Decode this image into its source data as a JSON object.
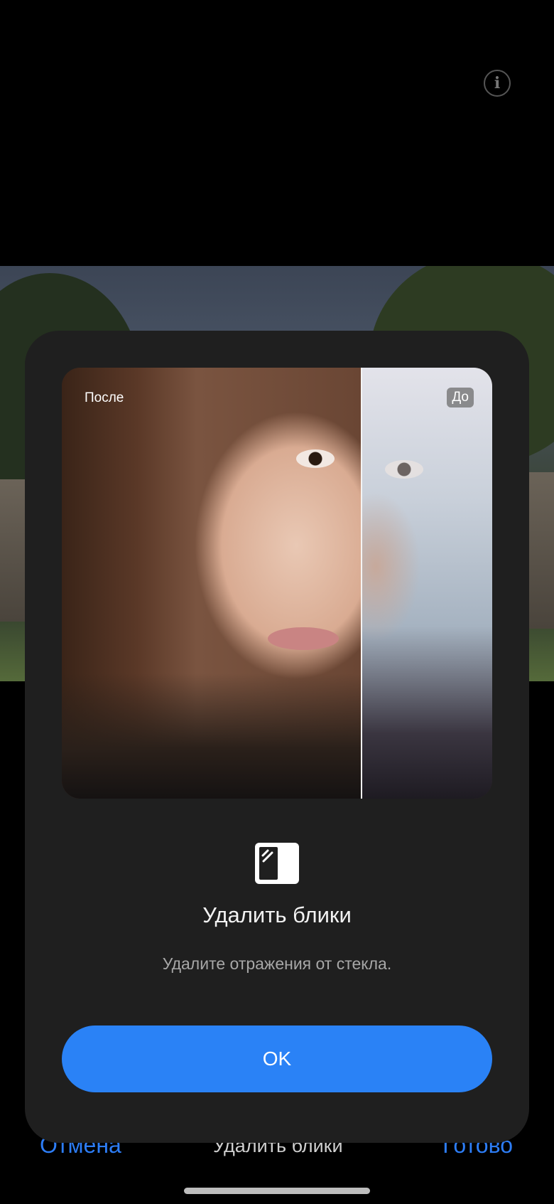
{
  "top_bar": {
    "info_icon": "info-circle-icon",
    "info_glyph": "i"
  },
  "bottom_bar": {
    "cancel_label": "Отмена",
    "mode_label": "Удалить блики",
    "done_label": "Готово"
  },
  "dialog": {
    "comparison": {
      "after_label": "После",
      "before_label": "До"
    },
    "feature_icon": "glass-reflection-icon",
    "title": "Удалить блики",
    "subtitle": "Удалите отражения от стекла.",
    "ok_label": "OK"
  },
  "colors": {
    "accent": "#2a82f6",
    "dialog_bg": "#1f1f1f",
    "screen_bg": "#000000"
  }
}
